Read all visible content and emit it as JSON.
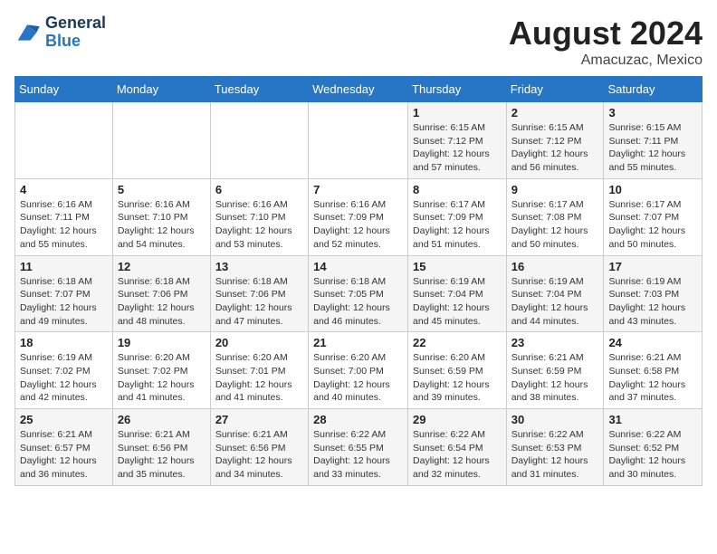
{
  "logo": {
    "line1": "General",
    "line2": "Blue"
  },
  "title": "August 2024",
  "subtitle": "Amacuzac, Mexico",
  "days_of_week": [
    "Sunday",
    "Monday",
    "Tuesday",
    "Wednesday",
    "Thursday",
    "Friday",
    "Saturday"
  ],
  "weeks": [
    [
      {
        "day": "",
        "info": ""
      },
      {
        "day": "",
        "info": ""
      },
      {
        "day": "",
        "info": ""
      },
      {
        "day": "",
        "info": ""
      },
      {
        "day": "1",
        "info": "Sunrise: 6:15 AM\nSunset: 7:12 PM\nDaylight: 12 hours\nand 57 minutes."
      },
      {
        "day": "2",
        "info": "Sunrise: 6:15 AM\nSunset: 7:12 PM\nDaylight: 12 hours\nand 56 minutes."
      },
      {
        "day": "3",
        "info": "Sunrise: 6:15 AM\nSunset: 7:11 PM\nDaylight: 12 hours\nand 55 minutes."
      }
    ],
    [
      {
        "day": "4",
        "info": "Sunrise: 6:16 AM\nSunset: 7:11 PM\nDaylight: 12 hours\nand 55 minutes."
      },
      {
        "day": "5",
        "info": "Sunrise: 6:16 AM\nSunset: 7:10 PM\nDaylight: 12 hours\nand 54 minutes."
      },
      {
        "day": "6",
        "info": "Sunrise: 6:16 AM\nSunset: 7:10 PM\nDaylight: 12 hours\nand 53 minutes."
      },
      {
        "day": "7",
        "info": "Sunrise: 6:16 AM\nSunset: 7:09 PM\nDaylight: 12 hours\nand 52 minutes."
      },
      {
        "day": "8",
        "info": "Sunrise: 6:17 AM\nSunset: 7:09 PM\nDaylight: 12 hours\nand 51 minutes."
      },
      {
        "day": "9",
        "info": "Sunrise: 6:17 AM\nSunset: 7:08 PM\nDaylight: 12 hours\nand 50 minutes."
      },
      {
        "day": "10",
        "info": "Sunrise: 6:17 AM\nSunset: 7:07 PM\nDaylight: 12 hours\nand 50 minutes."
      }
    ],
    [
      {
        "day": "11",
        "info": "Sunrise: 6:18 AM\nSunset: 7:07 PM\nDaylight: 12 hours\nand 49 minutes."
      },
      {
        "day": "12",
        "info": "Sunrise: 6:18 AM\nSunset: 7:06 PM\nDaylight: 12 hours\nand 48 minutes."
      },
      {
        "day": "13",
        "info": "Sunrise: 6:18 AM\nSunset: 7:06 PM\nDaylight: 12 hours\nand 47 minutes."
      },
      {
        "day": "14",
        "info": "Sunrise: 6:18 AM\nSunset: 7:05 PM\nDaylight: 12 hours\nand 46 minutes."
      },
      {
        "day": "15",
        "info": "Sunrise: 6:19 AM\nSunset: 7:04 PM\nDaylight: 12 hours\nand 45 minutes."
      },
      {
        "day": "16",
        "info": "Sunrise: 6:19 AM\nSunset: 7:04 PM\nDaylight: 12 hours\nand 44 minutes."
      },
      {
        "day": "17",
        "info": "Sunrise: 6:19 AM\nSunset: 7:03 PM\nDaylight: 12 hours\nand 43 minutes."
      }
    ],
    [
      {
        "day": "18",
        "info": "Sunrise: 6:19 AM\nSunset: 7:02 PM\nDaylight: 12 hours\nand 42 minutes."
      },
      {
        "day": "19",
        "info": "Sunrise: 6:20 AM\nSunset: 7:02 PM\nDaylight: 12 hours\nand 41 minutes."
      },
      {
        "day": "20",
        "info": "Sunrise: 6:20 AM\nSunset: 7:01 PM\nDaylight: 12 hours\nand 41 minutes."
      },
      {
        "day": "21",
        "info": "Sunrise: 6:20 AM\nSunset: 7:00 PM\nDaylight: 12 hours\nand 40 minutes."
      },
      {
        "day": "22",
        "info": "Sunrise: 6:20 AM\nSunset: 6:59 PM\nDaylight: 12 hours\nand 39 minutes."
      },
      {
        "day": "23",
        "info": "Sunrise: 6:21 AM\nSunset: 6:59 PM\nDaylight: 12 hours\nand 38 minutes."
      },
      {
        "day": "24",
        "info": "Sunrise: 6:21 AM\nSunset: 6:58 PM\nDaylight: 12 hours\nand 37 minutes."
      }
    ],
    [
      {
        "day": "25",
        "info": "Sunrise: 6:21 AM\nSunset: 6:57 PM\nDaylight: 12 hours\nand 36 minutes."
      },
      {
        "day": "26",
        "info": "Sunrise: 6:21 AM\nSunset: 6:56 PM\nDaylight: 12 hours\nand 35 minutes."
      },
      {
        "day": "27",
        "info": "Sunrise: 6:21 AM\nSunset: 6:56 PM\nDaylight: 12 hours\nand 34 minutes."
      },
      {
        "day": "28",
        "info": "Sunrise: 6:22 AM\nSunset: 6:55 PM\nDaylight: 12 hours\nand 33 minutes."
      },
      {
        "day": "29",
        "info": "Sunrise: 6:22 AM\nSunset: 6:54 PM\nDaylight: 12 hours\nand 32 minutes."
      },
      {
        "day": "30",
        "info": "Sunrise: 6:22 AM\nSunset: 6:53 PM\nDaylight: 12 hours\nand 31 minutes."
      },
      {
        "day": "31",
        "info": "Sunrise: 6:22 AM\nSunset: 6:52 PM\nDaylight: 12 hours\nand 30 minutes."
      }
    ]
  ]
}
